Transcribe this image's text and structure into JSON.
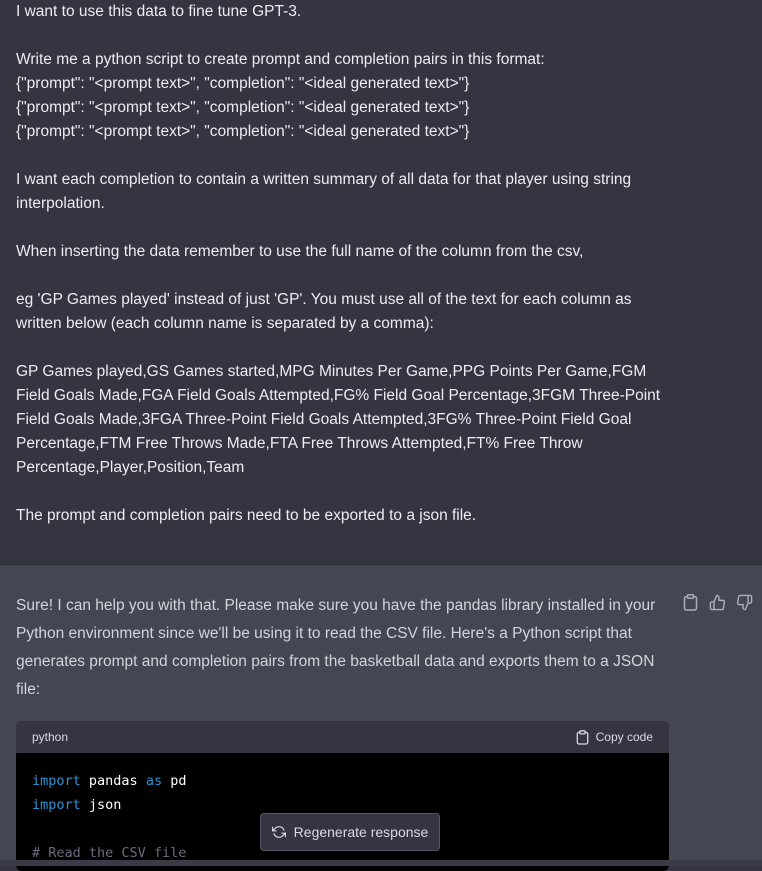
{
  "user_message": {
    "paragraphs": [
      "I want to use this data to fine tune GPT-3.",
      "Write me a python script to create prompt and completion pairs in this format:",
      "{\"prompt\": \"<prompt text>\", \"completion\": \"<ideal generated text>\"}",
      "{\"prompt\": \"<prompt text>\", \"completion\": \"<ideal generated text>\"}",
      "{\"prompt\": \"<prompt text>\", \"completion\": \"<ideal generated text>\"}",
      "I want each completion to contain a written summary of all data for that player using string interpolation.",
      "When inserting the data remember to use the full name of the column from the csv,",
      "eg 'GP  Games played' instead of just 'GP'. You must use all of the text for each column as written below (each column name is separated by a comma):",
      "GP  Games played,GS  Games started,MPG  Minutes Per Game,PPG  Points Per Game,FGM  Field Goals Made,FGA  Field Goals Attempted,FG%  Field Goal Percentage,3FGM  Three-Point Field Goals Made,3FGA  Three-Point Field Goals Attempted,3FG%  Three-Point Field Goal Percentage,FTM  Free Throws Made,FTA  Free Throws Attempted,FT%  Free Throw Percentage,Player,Position,Team",
      "The prompt and completion pairs need to be exported to a json file."
    ]
  },
  "assistant_message": {
    "text": "Sure! I can help you with that. Please make sure you have the pandas library installed in your Python environment since we'll be using it to read the CSV file. Here's a Python script that generates prompt and completion pairs from the basketball data and exports them to a JSON file:",
    "actions": [
      "clipboard-icon",
      "thumbs-up-icon",
      "thumbs-down-icon"
    ],
    "code_block": {
      "language": "python",
      "copy_label": "Copy code",
      "lines": [
        {
          "kw": "import",
          "rest": " pandas ",
          "kw2": "as",
          "rest2": " pd"
        },
        {
          "kw": "import",
          "rest": " json",
          "kw2": "",
          "rest2": ""
        }
      ],
      "comment": "# Read the CSV file"
    }
  },
  "regenerate_button": {
    "label": "Regenerate response"
  },
  "colors": {
    "user_bg": "#343541",
    "assistant_bg": "#444654",
    "code_keyword": "#2e95d3"
  }
}
